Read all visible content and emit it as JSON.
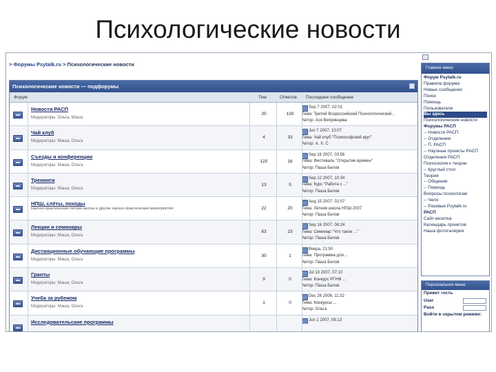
{
  "slide_title": "Психологические новости",
  "breadcrumb": {
    "prefix": ">",
    "root": "Форумы Psytalk.ru",
    "sep": ">",
    "current": "Психологические новости"
  },
  "forum_panel": {
    "title": "Психологические новости — подфорумы",
    "columns": {
      "forum": "Форум",
      "topics": "Тем",
      "replies": "Ответов",
      "last": "Последнее сообщение"
    },
    "rows": [
      {
        "name": "Новости РАСП",
        "mods": "Модераторы: Ольга, Маша",
        "desc": "",
        "topics": "20",
        "replies": "130",
        "date": "Sep 7 2007, 02:01",
        "topic": "Тема: Третий Всероссийский Психологический...",
        "author": "Автор: Ася Вепринцева"
      },
      {
        "name": "Чай клуб",
        "mods": "Модераторы: Маша, Ольга",
        "desc": "",
        "topics": "4",
        "replies": "33",
        "date": "Jun 7 2007, 10:07",
        "topic": "Тема: Чай клуб \"Психософский круг\"",
        "author": "Автор: А. Х. С"
      },
      {
        "name": "Съезды и конференции",
        "mods": "Модераторы: Маша, Ольга",
        "desc": "",
        "topics": "120",
        "replies": "16",
        "date": "Sep 16 2007, 03:56",
        "topic": "Тема: Фестиваль \"Открытие времен\"",
        "author": "Автор: Паша Белов"
      },
      {
        "name": "Тренинги",
        "mods": "Модераторы: Маша, Ольга",
        "desc": "",
        "topics": "13",
        "replies": "5",
        "date": "Sep 12 2007, 10:34",
        "topic": "Тема: Курс \"Работа с ...\"",
        "author": "Автор: Паша Белов"
      },
      {
        "name": "НПШ, слёты, походы",
        "mods": "",
        "desc": "Научно-практические летние школы и другие научно-практические мероприятия",
        "topics": "22",
        "replies": "20",
        "date": "Aug 15 2007, 02:07",
        "topic": "Тема: Летняя школа НПШ 2007",
        "author": "Автор: Паша Белов"
      },
      {
        "name": "Лекции и семинары",
        "mods": "Модераторы: Маша, Ольга",
        "desc": "",
        "topics": "63",
        "replies": "23",
        "date": "Sep 16 2007, 08:24",
        "topic": "Тема: Семинар \"Что такое ...\"",
        "author": "Автор: Паша Белов"
      },
      {
        "name": "Дистанционные обучающие программы",
        "mods": "Модераторы: Маша, Ольга",
        "desc": "",
        "topics": "30",
        "replies": "1",
        "date": "Вчера, 21:50",
        "topic": "Тема: Программа для ...",
        "author": "Автор: Паша Белов"
      },
      {
        "name": "Гранты",
        "mods": "Модераторы: Маша, Ольга",
        "desc": "",
        "topics": "9",
        "replies": "0",
        "date": "Jul 13 2007, 07:10",
        "topic": "Тема: Конкурс РГНФ ...",
        "author": "Автор: Паша Белов"
      },
      {
        "name": "Учеба за рубежом",
        "mods": "Модераторы: Маша, Ольга",
        "desc": "",
        "topics": "1",
        "replies": "0",
        "date": "Dec 26 2006, 11:32",
        "topic": "Тема: Конкурсы ...",
        "author": "Автор: Ольга"
      },
      {
        "name": "Исследовательские программы",
        "mods": "",
        "desc": "",
        "topics": "",
        "replies": "",
        "date": "Jun 1 2007, 08:13",
        "topic": "",
        "author": ""
      }
    ]
  },
  "side_menu": {
    "title": "Главное меню",
    "items": [
      {
        "label": "Форум Psytalk.ru",
        "style": "b"
      },
      {
        "label": "Правила форума",
        "style": ""
      },
      {
        "label": "Новые сообщения",
        "style": ""
      },
      {
        "label": "Поиск",
        "style": ""
      },
      {
        "label": "Помощь",
        "style": ""
      },
      {
        "label": "Пользователи",
        "style": ""
      },
      {
        "label": "Вы здесь",
        "style": "hl"
      },
      {
        "label": "Психологические новости",
        "style": ""
      },
      {
        "label": "Форумы РАСП",
        "style": "b"
      },
      {
        "label": "-- Новости РАСП",
        "style": ""
      },
      {
        "label": "-- Отделения",
        "style": ""
      },
      {
        "label": "-- П. РАСП",
        "style": ""
      },
      {
        "label": "-- Научные проекты РАСП",
        "style": ""
      },
      {
        "label": "Отделения РАСП",
        "style": ""
      },
      {
        "label": "Психология к теории",
        "style": ""
      },
      {
        "label": "-- Круглый стол",
        "style": ""
      },
      {
        "label": "   Теория",
        "style": ""
      },
      {
        "label": "-- Общение",
        "style": ""
      },
      {
        "label": "-- Помощь",
        "style": ""
      },
      {
        "label": "   Вопросы психологам",
        "style": ""
      },
      {
        "label": "-- Чело",
        "style": ""
      },
      {
        "label": "-- Разовые Psytalk.ru",
        "style": ""
      },
      {
        "label": "РАСП",
        "style": "b"
      },
      {
        "label": "Сайт-визитка",
        "style": ""
      },
      {
        "label": "Календарь проектов",
        "style": ""
      },
      {
        "label": "Наша фотогалерея",
        "style": ""
      }
    ]
  },
  "login_panel": {
    "title": "Персональное меню",
    "greeting": "Привет гость",
    "user_label": "User",
    "pass_label": "Pass",
    "hidden_label": "Войти в скрытом режиме:"
  }
}
